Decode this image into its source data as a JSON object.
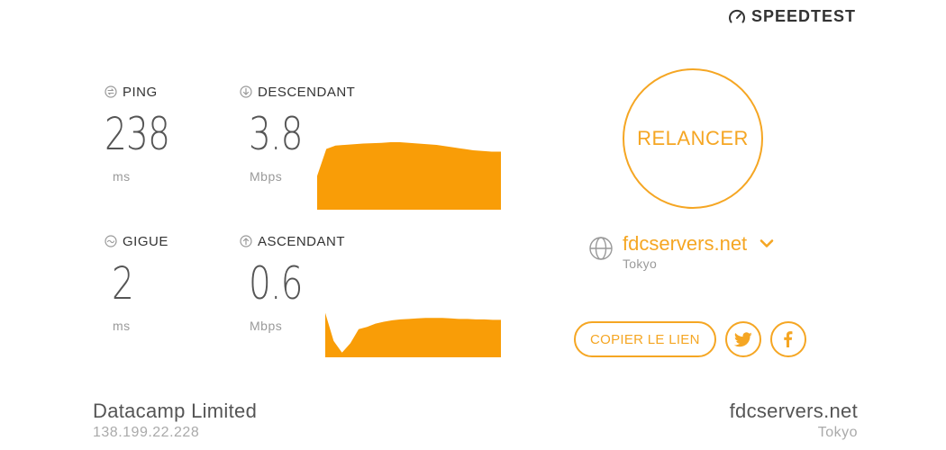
{
  "brand": {
    "name": "SPEEDTEST",
    "icon": "speedometer-icon"
  },
  "metrics": {
    "ping": {
      "label": "PING",
      "value": "238",
      "unit": "ms",
      "icon": "ping-icon"
    },
    "download": {
      "label": "DESCENDANT",
      "value": "3.8",
      "unit": "Mbps",
      "icon": "download-arrow-icon"
    },
    "jitter": {
      "label": "GIGUE",
      "value": "2",
      "unit": "ms",
      "icon": "jitter-icon"
    },
    "upload": {
      "label": "ASCENDANT",
      "value": "0.6",
      "unit": "Mbps",
      "icon": "upload-arrow-icon"
    }
  },
  "graphs": {
    "download_fill": [
      0.5,
      0.9,
      0.95,
      0.96,
      0.97,
      0.98,
      0.985,
      0.99,
      1.0,
      1.0,
      0.99,
      0.98,
      0.97,
      0.96,
      0.94,
      0.92,
      0.9,
      0.88,
      0.87,
      0.86,
      0.86
    ],
    "upload_fill": [
      0.95,
      0.35,
      0.1,
      0.3,
      0.6,
      0.65,
      0.72,
      0.76,
      0.79,
      0.81,
      0.82,
      0.83,
      0.84,
      0.84,
      0.84,
      0.83,
      0.82,
      0.82,
      0.81,
      0.81,
      0.8,
      0.8
    ],
    "color": "#f99d07"
  },
  "rerun": {
    "label": "RELANCER"
  },
  "server": {
    "name": "fdcservers.net",
    "city": "Tokyo",
    "icon": "globe-icon"
  },
  "share": {
    "copy_label": "COPIER LE LIEN",
    "twitter_icon": "twitter-icon",
    "facebook_icon": "facebook-icon"
  },
  "isp": {
    "name": "Datacamp Limited",
    "ip": "138.199.22.228"
  },
  "host": {
    "name": "fdcservers.net",
    "city": "Tokyo"
  },
  "colors": {
    "accent": "#f5a623",
    "text": "#333333",
    "muted": "#9a9a9a"
  }
}
